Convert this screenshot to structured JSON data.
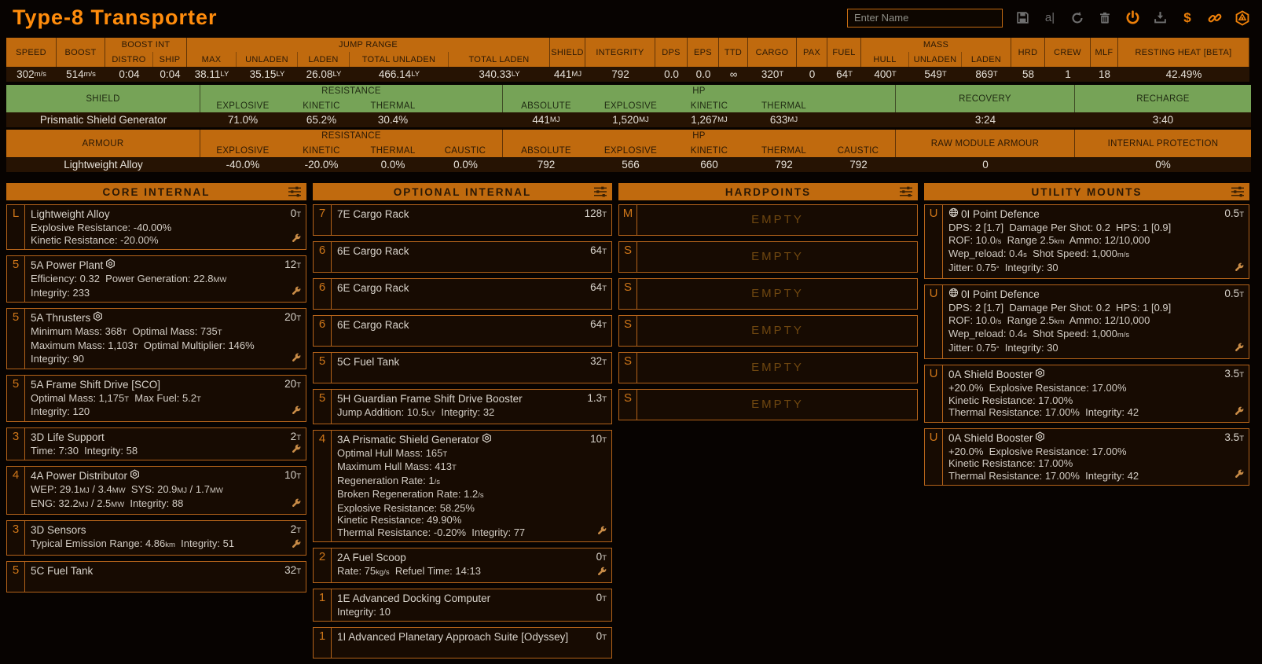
{
  "app": {
    "title": "Type-8 Transporter"
  },
  "topbar": {
    "name_input": {
      "placeholder": "Enter Name",
      "value": ""
    },
    "icons": [
      {
        "name": "save",
        "glyph": "floppy",
        "color": "gray"
      },
      {
        "name": "rename",
        "glyph": "rename",
        "color": "gray",
        "label": "a|"
      },
      {
        "name": "reload",
        "glyph": "reload",
        "color": "gray"
      },
      {
        "name": "delete",
        "glyph": "trash",
        "color": "gray"
      },
      {
        "name": "power",
        "glyph": "power",
        "color": "orange"
      },
      {
        "name": "import",
        "glyph": "import",
        "color": "gray"
      },
      {
        "name": "price",
        "glyph": "dollar",
        "color": "orange",
        "label": "$"
      },
      {
        "name": "permalink",
        "glyph": "link",
        "color": "orange"
      },
      {
        "name": "shipyard",
        "glyph": "logo",
        "color": "orange"
      }
    ]
  },
  "stats": {
    "groups": [
      {
        "label": "SPEED",
        "cells": [
          {
            "v": "302",
            "u": "m/s"
          }
        ]
      },
      {
        "label": "BOOST",
        "cells": [
          {
            "v": "514",
            "u": "m/s"
          }
        ]
      },
      {
        "label": "BOOST INT",
        "subs": [
          "DISTRO",
          "SHIP"
        ],
        "cells": [
          {
            "v": "0:04"
          },
          {
            "v": "0:04"
          }
        ]
      },
      {
        "label": "JUMP RANGE",
        "subs": [
          "MAX",
          "UNLADEN",
          "LADEN",
          "TOTAL UNLADEN",
          "TOTAL LADEN"
        ],
        "cells": [
          {
            "v": "38.11",
            "u": "LY"
          },
          {
            "v": "35.15",
            "u": "LY"
          },
          {
            "v": "26.08",
            "u": "LY"
          },
          {
            "v": "466.14",
            "u": "LY"
          },
          {
            "v": "340.33",
            "u": "LY"
          }
        ]
      },
      {
        "label": "SHIELD",
        "cells": [
          {
            "v": "441",
            "u": "MJ"
          }
        ]
      },
      {
        "label": "INTEGRITY",
        "cells": [
          {
            "v": "792"
          }
        ]
      },
      {
        "label": "DPS",
        "cells": [
          {
            "v": "0.0"
          }
        ]
      },
      {
        "label": "EPS",
        "cells": [
          {
            "v": "0.0"
          }
        ]
      },
      {
        "label": "TTD",
        "cells": [
          {
            "v": "∞"
          }
        ]
      },
      {
        "label": "CARGO",
        "cells": [
          {
            "v": "320",
            "u": "T"
          }
        ]
      },
      {
        "label": "PAX",
        "cells": [
          {
            "v": "0"
          }
        ]
      },
      {
        "label": "FUEL",
        "cells": [
          {
            "v": "64",
            "u": "T"
          }
        ]
      },
      {
        "label": "MASS",
        "subs": [
          "HULL",
          "UNLADEN",
          "LADEN"
        ],
        "cells": [
          {
            "v": "400",
            "u": "T"
          },
          {
            "v": "549",
            "u": "T"
          },
          {
            "v": "869",
            "u": "T"
          }
        ]
      },
      {
        "label": "HRD",
        "cells": [
          {
            "v": "58"
          }
        ]
      },
      {
        "label": "CREW",
        "cells": [
          {
            "v": "1"
          }
        ]
      },
      {
        "label": "MLF",
        "cells": [
          {
            "v": "18"
          }
        ]
      },
      {
        "label": "RESTING HEAT [BETA]",
        "cells": [
          {
            "v": "42.49%"
          }
        ]
      }
    ]
  },
  "defense": {
    "shield": {
      "label": "SHIELD",
      "module": "Prismatic Shield Generator",
      "theme": "green",
      "resistance": {
        "label": "RESISTANCE",
        "cols": [
          "EXPLOSIVE",
          "KINETIC",
          "THERMAL",
          ""
        ],
        "values": [
          "71.0%",
          "65.2%",
          "30.4%",
          ""
        ]
      },
      "hp": {
        "label": "HP",
        "cols": [
          "ABSOLUTE",
          "EXPLOSIVE",
          "KINETIC",
          "THERMAL",
          ""
        ],
        "values": [
          "441MJ",
          "1,520MJ",
          "1,267MJ",
          "633MJ",
          ""
        ]
      },
      "extras": [
        {
          "label": "RECOVERY",
          "value": "3:24"
        },
        {
          "label": "RECHARGE",
          "value": "3:40"
        }
      ]
    },
    "armour": {
      "label": "ARMOUR",
      "module": "Lightweight Alloy",
      "theme": "orange",
      "resistance": {
        "label": "RESISTANCE",
        "cols": [
          "EXPLOSIVE",
          "KINETIC",
          "THERMAL",
          "CAUSTIC"
        ],
        "values": [
          "-40.0%",
          "-20.0%",
          "0.0%",
          "0.0%"
        ]
      },
      "hp": {
        "label": "HP",
        "cols": [
          "ABSOLUTE",
          "EXPLOSIVE",
          "KINETIC",
          "THERMAL",
          "CAUSTIC"
        ],
        "values": [
          "792",
          "566",
          "660",
          "792",
          "792"
        ]
      },
      "extras": [
        {
          "label": "RAW MODULE ARMOUR",
          "value": "0"
        },
        {
          "label": "INTERNAL PROTECTION",
          "value": "0%"
        }
      ]
    }
  },
  "panels": [
    {
      "id": "core-internal",
      "title": "CORE INTERNAL",
      "modules": [
        {
          "slot": "L",
          "name": "Lightweight Alloy",
          "mass": "0T",
          "lines": [
            "Explosive Resistance: -40.00%",
            "Kinetic Resistance: -20.00%"
          ],
          "wrench": true
        },
        {
          "slot": "5",
          "name": "5A Power Plant",
          "engineered": true,
          "mass": "12T",
          "lines": [
            "Efficiency: 0.32  Power Generation: 22.8MW",
            "Integrity: 233"
          ],
          "wrench": true
        },
        {
          "slot": "5",
          "name": "5A Thrusters",
          "engineered": true,
          "mass": "20T",
          "lines": [
            "Minimum Mass: 368T  Optimal Mass: 735T",
            "Maximum Mass: 1,103T  Optimal Multiplier: 146%",
            "Integrity: 90"
          ],
          "wrench": true
        },
        {
          "slot": "5",
          "name": "5A Frame Shift Drive [SCO]",
          "mass": "20T",
          "lines": [
            "Optimal Mass: 1,175T  Max Fuel: 5.2T",
            "Integrity: 120"
          ],
          "wrench": true
        },
        {
          "slot": "3",
          "name": "3D Life Support",
          "mass": "2T",
          "lines": [
            "Time: 7:30  Integrity: 58"
          ],
          "wrench": true
        },
        {
          "slot": "4",
          "name": "4A Power Distributor",
          "engineered": true,
          "mass": "10T",
          "lines": [
            "WEP: 29.1MJ / 3.4MW  SYS: 20.9MJ / 1.7MW",
            "ENG: 32.2MJ / 2.5MW  Integrity: 88"
          ],
          "wrench": true
        },
        {
          "slot": "3",
          "name": "3D Sensors",
          "mass": "2T",
          "lines": [
            "Typical Emission Range: 4.86km  Integrity: 51"
          ],
          "wrench": true
        },
        {
          "slot": "5",
          "name": "5C Fuel Tank",
          "mass": "32T",
          "lines": []
        }
      ]
    },
    {
      "id": "optional-internal",
      "title": "OPTIONAL INTERNAL",
      "modules": [
        {
          "slot": "7",
          "name": "7E Cargo Rack",
          "mass": "128T",
          "lines": []
        },
        {
          "slot": "6",
          "name": "6E Cargo Rack",
          "mass": "64T",
          "lines": []
        },
        {
          "slot": "6",
          "name": "6E Cargo Rack",
          "mass": "64T",
          "lines": []
        },
        {
          "slot": "6",
          "name": "6E Cargo Rack",
          "mass": "64T",
          "lines": []
        },
        {
          "slot": "5",
          "name": "5C Fuel Tank",
          "mass": "32T",
          "lines": []
        },
        {
          "slot": "5",
          "name": "5H Guardian Frame Shift Drive Booster",
          "mass": "1.3T",
          "lines": [
            "Jump Addition: 10.5LY  Integrity: 32"
          ]
        },
        {
          "slot": "4",
          "name": "3A Prismatic Shield Generator",
          "engineered": true,
          "mass": "10T",
          "lines": [
            "Optimal Hull Mass: 165T",
            "Maximum Hull Mass: 413T",
            "Regeneration Rate: 1/s",
            "Broken Regeneration Rate: 1.2/s",
            "Explosive Resistance: 58.25%",
            "Kinetic Resistance: 49.90%",
            "Thermal Resistance: -0.20%  Integrity: 77"
          ],
          "wrench": true
        },
        {
          "slot": "2",
          "name": "2A Fuel Scoop",
          "mass": "0T",
          "lines": [
            "Rate: 75kg/s  Refuel Time: 14:13"
          ],
          "wrench": true
        },
        {
          "slot": "1",
          "name": "1E Advanced Docking Computer",
          "mass": "0T",
          "lines": [
            "Integrity: 10"
          ]
        },
        {
          "slot": "1",
          "name": "1I Advanced Planetary Approach Suite [Odyssey]",
          "mass": "0T",
          "lines": []
        }
      ]
    },
    {
      "id": "hardpoints",
      "title": "HARDPOINTS",
      "modules": [
        {
          "slot": "M",
          "empty": true,
          "name": "EMPTY"
        },
        {
          "slot": "S",
          "empty": true,
          "name": "EMPTY"
        },
        {
          "slot": "S",
          "empty": true,
          "name": "EMPTY"
        },
        {
          "slot": "S",
          "empty": true,
          "name": "EMPTY"
        },
        {
          "slot": "S",
          "empty": true,
          "name": "EMPTY"
        },
        {
          "slot": "S",
          "empty": true,
          "name": "EMPTY"
        }
      ]
    },
    {
      "id": "utility-mounts",
      "title": "UTILITY MOUNTS",
      "modules": [
        {
          "slot": "U",
          "mount_icon": "turret",
          "name": "0I Point Defence",
          "mass": "0.5T",
          "lines": [
            "DPS: 2 [1.7]  Damage Per Shot: 0.2  HPS: 1 [0.9]",
            "ROF: 10.0/s  Range 2.5km  Ammo: 12/10,000",
            "Wep_reload: 0.4s  Shot Speed: 1,000m/s",
            "Jitter: 0.75°  Integrity: 30"
          ],
          "wrench": true
        },
        {
          "slot": "U",
          "mount_icon": "turret",
          "name": "0I Point Defence",
          "mass": "0.5T",
          "lines": [
            "DPS: 2 [1.7]  Damage Per Shot: 0.2  HPS: 1 [0.9]",
            "ROF: 10.0/s  Range 2.5km  Ammo: 12/10,000",
            "Wep_reload: 0.4s  Shot Speed: 1,000m/s",
            "Jitter: 0.75°  Integrity: 30"
          ],
          "wrench": true
        },
        {
          "slot": "U",
          "name": "0A Shield Booster",
          "engineered": true,
          "mass": "3.5T",
          "lines": [
            "+20.0%  Explosive Resistance: 17.00%",
            "Kinetic Resistance: 17.00%",
            "Thermal Resistance: 17.00%  Integrity: 42"
          ],
          "wrench": true
        },
        {
          "slot": "U",
          "name": "0A Shield Booster",
          "engineered": true,
          "mass": "3.5T",
          "lines": [
            "+20.0%  Explosive Resistance: 17.00%",
            "Kinetic Resistance: 17.00%",
            "Thermal Resistance: 17.00%  Integrity: 42"
          ],
          "wrench": true
        }
      ]
    }
  ]
}
